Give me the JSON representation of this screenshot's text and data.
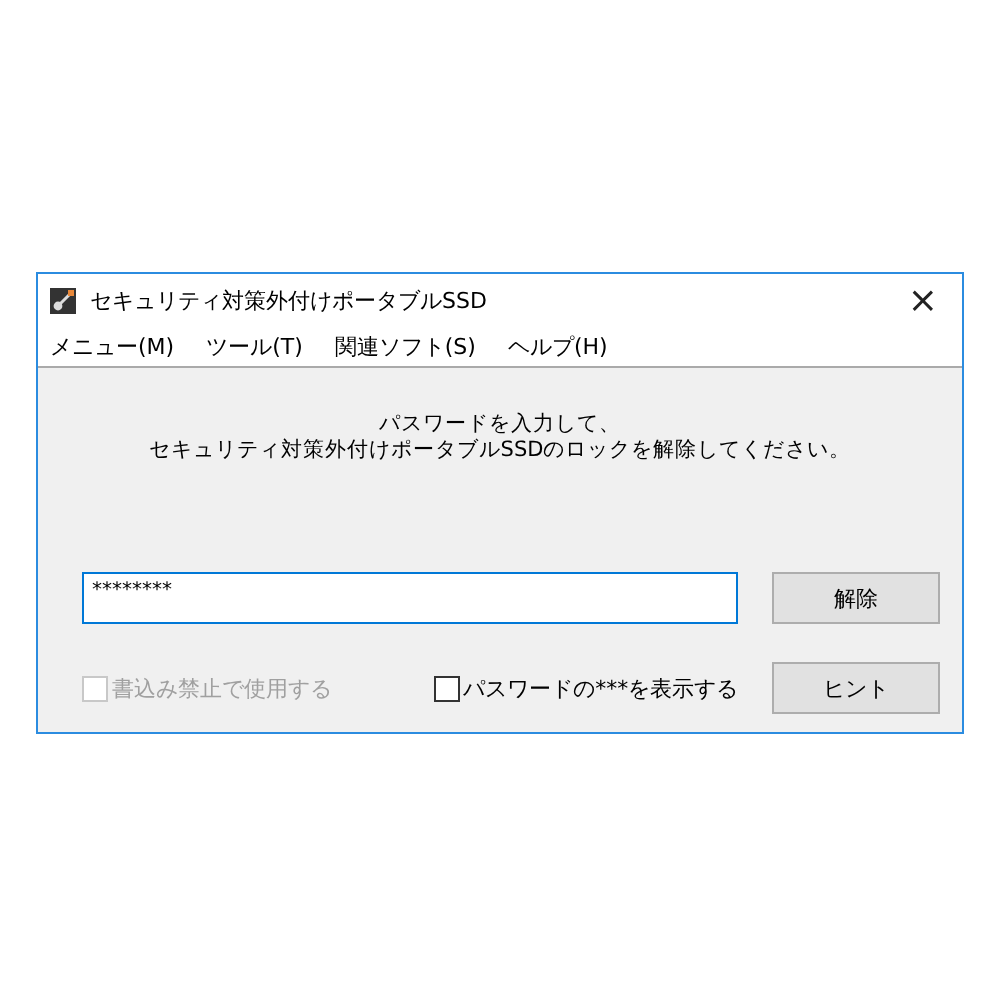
{
  "window": {
    "title": "セキュリティ対策外付けポータブルSSD",
    "close": "×"
  },
  "menu": [
    "メニュー(M)",
    "ツール(T)",
    "関連ソフト(S)",
    "ヘルプ(H)"
  ],
  "message": [
    "パスワードを入力して、",
    "セキュリティ対策外付けポータブルSSDのロックを解除してください。"
  ],
  "password": {
    "value": "********"
  },
  "unlock_button": "解除",
  "checkboxes": [
    {
      "label": "書込み禁止で使用する",
      "checked": false,
      "disabled": true
    },
    {
      "label": "パスワードの***を表示する",
      "checked": false,
      "disabled": false
    }
  ],
  "hint_button": "ヒント"
}
